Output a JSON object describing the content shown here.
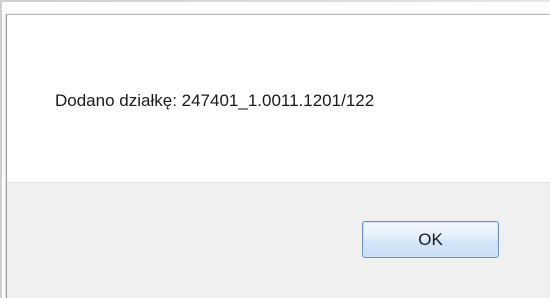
{
  "dialog": {
    "message": "Dodano działkę: 247401_1.0011.1201/122",
    "ok_label": "OK"
  }
}
